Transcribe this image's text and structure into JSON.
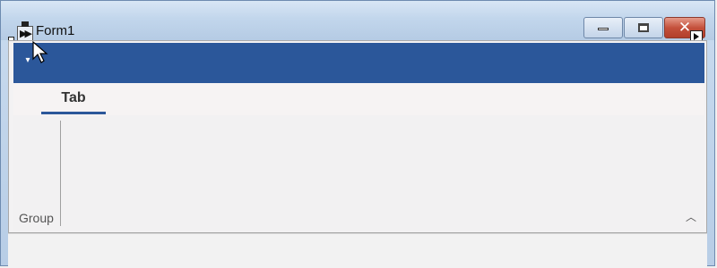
{
  "window": {
    "title": "Form1",
    "icon": "app-icon",
    "buttons": {
      "minimize": "minimize-icon",
      "maximize": "maximize-icon",
      "close": "close-icon",
      "close_symbol": "✕"
    },
    "accent_color": "#2b579a"
  },
  "quick_access": {
    "icon": "customize-qat-icon",
    "symbol": "▾"
  },
  "ribbon": {
    "tabs": [
      {
        "label": "Tab",
        "selected": true
      }
    ],
    "groups": [
      {
        "label": "Group"
      }
    ],
    "collapse_symbol": "︿"
  }
}
